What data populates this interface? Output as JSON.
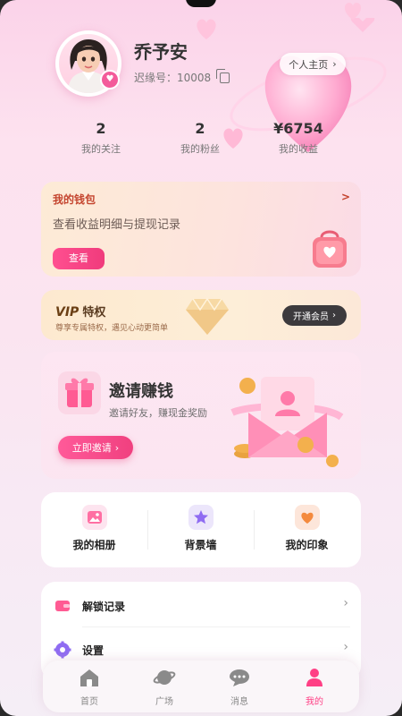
{
  "profile": {
    "name": "乔予安",
    "id_label": "迟缘号：",
    "id_value": "10008",
    "homepage_label": "个人主页"
  },
  "stats": [
    {
      "value": "2",
      "label": "我的关注"
    },
    {
      "value": "2",
      "label": "我的粉丝"
    },
    {
      "value": "¥6754",
      "label": "我的收益"
    }
  ],
  "wallet": {
    "title": "我的钱包",
    "arrow": ">",
    "description": "查看收益明细与提现记录",
    "button": "查看"
  },
  "vip": {
    "badge": "VIP",
    "title": "特权",
    "subtitle": "尊享专属特权，遇见心动更简单",
    "button": "开通会员"
  },
  "invite": {
    "title": "邀请赚钱",
    "subtitle": "邀请好友，赚现金奖励",
    "button": "立即邀请"
  },
  "shortcuts": [
    {
      "label": "我的相册",
      "icon": "album-icon"
    },
    {
      "label": "背景墙",
      "icon": "star-icon"
    },
    {
      "label": "我的印象",
      "icon": "heart-tag-icon"
    }
  ],
  "menu": [
    {
      "label": "解锁记录",
      "icon": "wallet-icon"
    },
    {
      "label": "设置",
      "icon": "gear-icon"
    }
  ],
  "tabs": [
    {
      "label": "首页",
      "icon": "home-icon",
      "active": false
    },
    {
      "label": "广场",
      "icon": "planet-icon",
      "active": false
    },
    {
      "label": "消息",
      "icon": "chat-icon",
      "active": false
    },
    {
      "label": "我的",
      "icon": "person-icon",
      "active": true
    }
  ],
  "colors": {
    "accent": "#ff3f85",
    "wallet_title": "#c4442e",
    "background_top": "#fbd3e9"
  }
}
